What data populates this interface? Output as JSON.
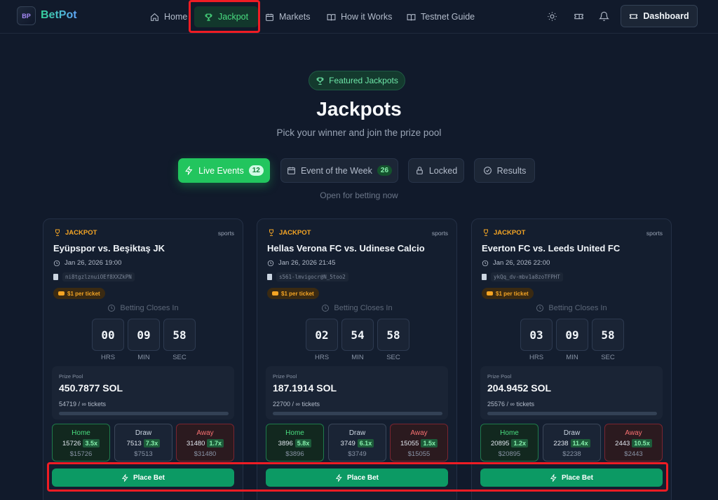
{
  "nav": {
    "logo_text": "BP",
    "brand": "BetPot",
    "items": [
      {
        "label": "Home",
        "icon": "home-icon"
      },
      {
        "label": "Jackpot",
        "icon": "trophy-icon"
      },
      {
        "label": "Markets",
        "icon": "calendar-icon"
      },
      {
        "label": "How it Works",
        "icon": "book-icon"
      },
      {
        "label": "Testnet Guide",
        "icon": "book-icon"
      }
    ],
    "dashboard_label": "Dashboard"
  },
  "hero": {
    "badge": "Featured Jackpots",
    "title": "Jackpots",
    "subtitle": "Pick your winner and join the prize pool"
  },
  "tabs": [
    {
      "label": "Live Events",
      "count": "12"
    },
    {
      "label": "Event of the Week",
      "count": "26"
    },
    {
      "label": "Locked"
    },
    {
      "label": "Results"
    }
  ],
  "tab_hint": "Open for betting now",
  "card_common": {
    "jackpot_tag": "JACKPOT",
    "category": "sports",
    "price": "$1 per ticket",
    "closes_label": "Betting Closes In",
    "hrs": "HRS",
    "min": "MIN",
    "sec": "SEC",
    "pool_label": "Prize Pool",
    "home": "Home",
    "draw": "Draw",
    "away": "Away",
    "place_bet": "Place Bet"
  },
  "cards": [
    {
      "match": "Eyüpspor vs. Beşiktaş JK",
      "date": "Jan 26, 2026 19:00",
      "hash": "ni8tgzlznuiOEf8XXZkPN",
      "timer": {
        "h": "00",
        "m": "09",
        "s": "58"
      },
      "pool": "450.7877 SOL",
      "tickets": "54719 / ∞ tickets",
      "home": {
        "count": "15726",
        "odds": "3.5x",
        "amount": "$15726"
      },
      "draw": {
        "count": "7513",
        "odds": "7.3x",
        "amount": "$7513"
      },
      "away": {
        "count": "31480",
        "odds": "1.7x",
        "amount": "$31480"
      }
    },
    {
      "match": "Hellas Verona FC vs. Udinese Calcio",
      "date": "Jan 26, 2026 21:45",
      "hash": "s561-lmvigocr@N_5too2",
      "timer": {
        "h": "02",
        "m": "54",
        "s": "58"
      },
      "pool": "187.1914 SOL",
      "tickets": "22700 / ∞ tickets",
      "home": {
        "count": "3896",
        "odds": "5.8x",
        "amount": "$3896"
      },
      "draw": {
        "count": "3749",
        "odds": "6.1x",
        "amount": "$3749"
      },
      "away": {
        "count": "15055",
        "odds": "1.5x",
        "amount": "$15055"
      }
    },
    {
      "match": "Everton FC vs. Leeds United FC",
      "date": "Jan 26, 2026 22:00",
      "hash": "ykQq_dv-mbv1a8zoTFPHT",
      "timer": {
        "h": "03",
        "m": "09",
        "s": "58"
      },
      "pool": "204.9452 SOL",
      "tickets": "25576 / ∞ tickets",
      "home": {
        "count": "20895",
        "odds": "1.2x",
        "amount": "$20895"
      },
      "draw": {
        "count": "2238",
        "odds": "11.4x",
        "amount": "$2238"
      },
      "away": {
        "count": "2443",
        "odds": "10.5x",
        "amount": "$2443"
      }
    }
  ],
  "colors": {
    "accent": "#22c55e",
    "highlight": "#ef1c24",
    "gold": "#f5a524"
  }
}
